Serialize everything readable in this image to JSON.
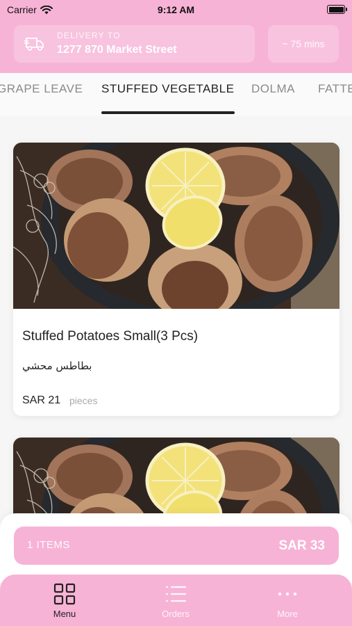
{
  "status_bar": {
    "carrier": "Carrier",
    "time": "9:12 AM"
  },
  "header": {
    "delivery_label": "DELIVERY TO",
    "address": "1277 870 Market Street",
    "eta": "~ 75 mins"
  },
  "tabs": [
    {
      "label": "GRAPE LEAVE",
      "active": false
    },
    {
      "label": "STUFFED VEGETABLE",
      "active": true
    },
    {
      "label": "DOLMA",
      "active": false
    },
    {
      "label": "FATTE",
      "active": false
    }
  ],
  "menu_items": [
    {
      "name": "Stuffed Potatoes Small(3 Pcs)",
      "arabic_name": "بطاطس محشي",
      "price": "SAR 21",
      "unit": "pieces"
    },
    {
      "name": "",
      "arabic_name": "",
      "price": "",
      "unit": ""
    }
  ],
  "cart": {
    "count": "1 ITEMS",
    "total": "SAR 33"
  },
  "bottom_nav": [
    {
      "label": "Menu",
      "icon": "grid-icon",
      "active": true
    },
    {
      "label": "Orders",
      "icon": "list-icon",
      "active": false
    },
    {
      "label": "More",
      "icon": "more-icon",
      "active": false
    }
  ],
  "colors": {
    "brand_pink": "#f7b3d6",
    "text_dark": "#222222",
    "muted": "#8a8a8a"
  }
}
